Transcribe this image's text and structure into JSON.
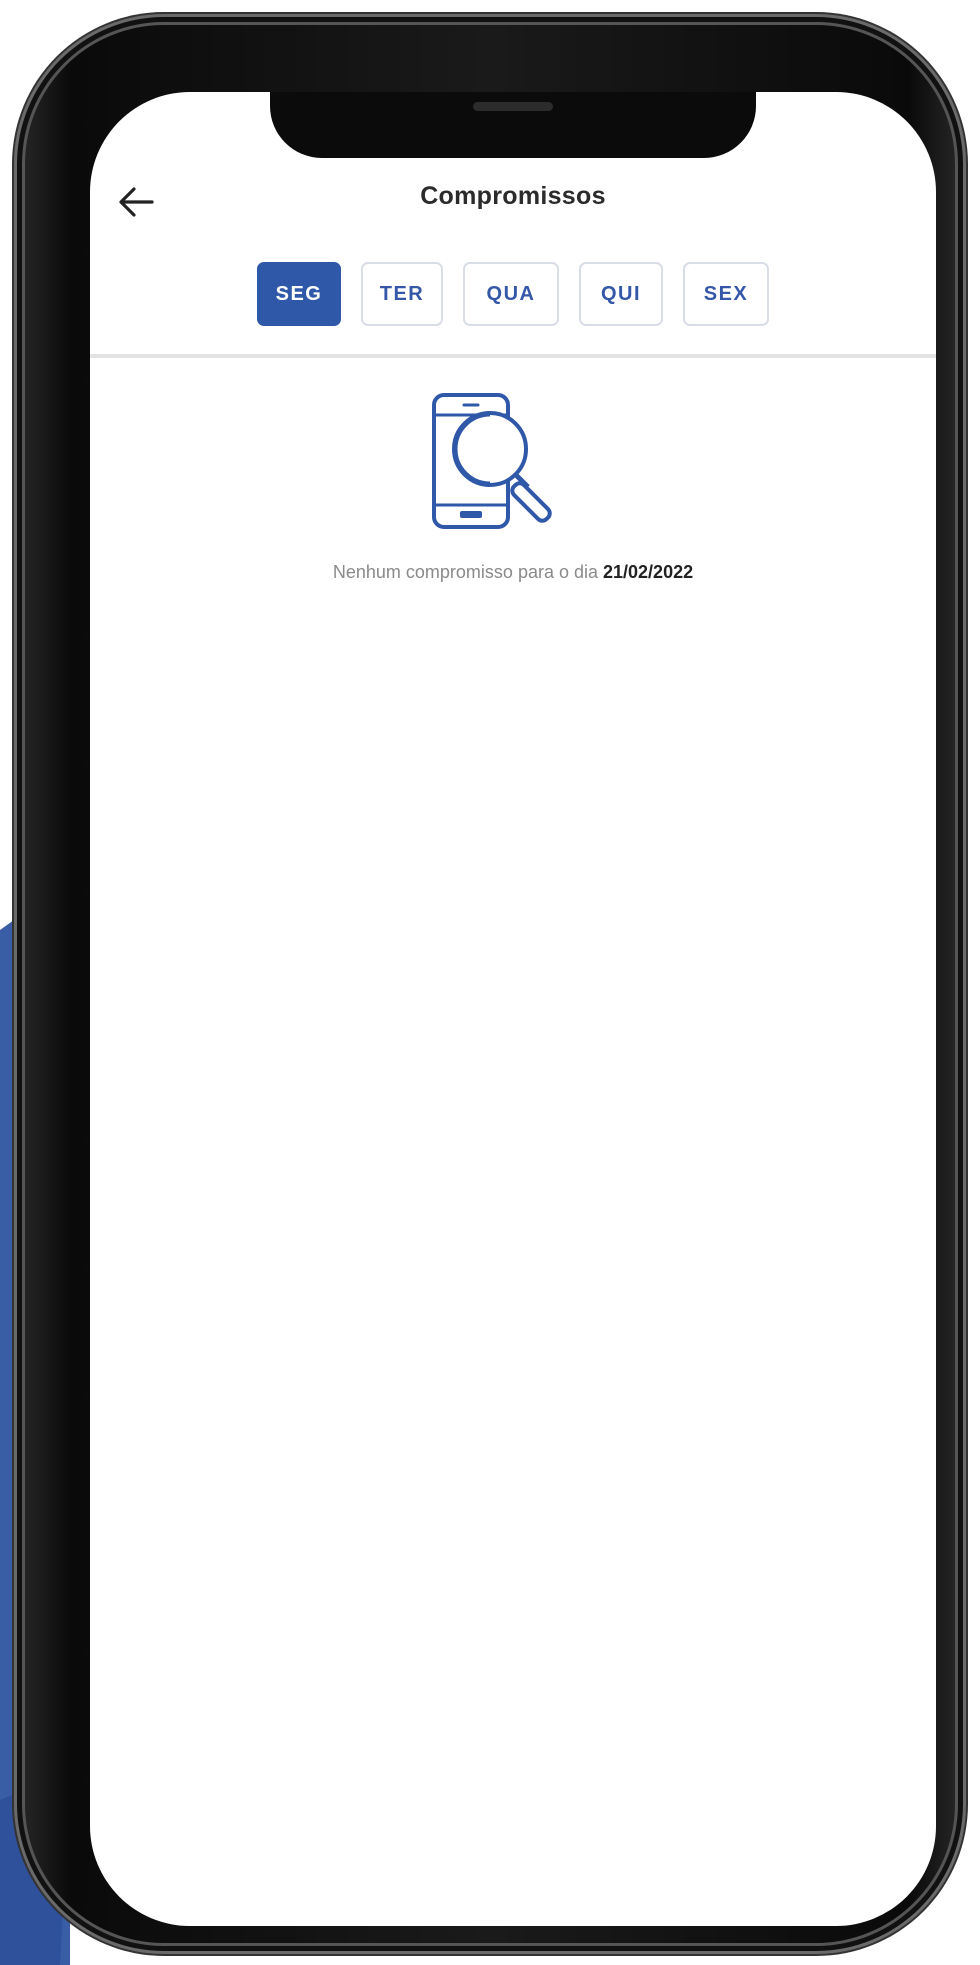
{
  "header": {
    "title": "Compromissos",
    "back_icon": "arrow-left-icon"
  },
  "tabs": [
    {
      "label": "SEG",
      "active": true
    },
    {
      "label": "TER",
      "active": false
    },
    {
      "label": "QUA",
      "active": false
    },
    {
      "label": "QUI",
      "active": false
    },
    {
      "label": "SEX",
      "active": false
    }
  ],
  "empty_state": {
    "icon": "phone-search-icon",
    "message": "Nenhum compromisso para o dia",
    "date": "21/02/2022"
  },
  "colors": {
    "accent": "#2f58a8",
    "background_wedge": "#3a5ea6"
  }
}
